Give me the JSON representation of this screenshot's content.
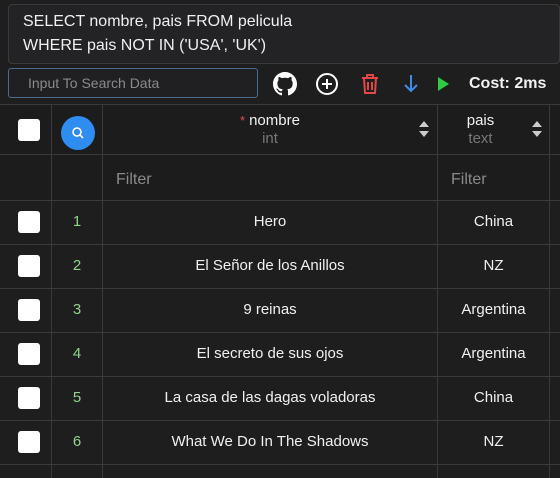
{
  "editor": {
    "line1": "SELECT nombre, pais FROM pelicula",
    "line2": "WHERE pais NOT IN ('USA', 'UK')"
  },
  "toolbar": {
    "search_placeholder": "Input To Search Data",
    "icons": [
      "github-icon",
      "add-circle-icon",
      "delete-icon",
      "download-icon",
      "run-icon"
    ],
    "cost_label": "Cost: 2ms",
    "colors": {
      "delete": "#e04848",
      "download": "#3b8de8",
      "run": "#2ecc40"
    }
  },
  "table": {
    "columns": [
      {
        "name": "nombre",
        "type": "int",
        "required": "*"
      },
      {
        "name": "pais",
        "type": "text"
      }
    ],
    "filter_placeholders": {
      "nombre": "Filter",
      "pais": "Filter"
    },
    "rows": [
      {
        "num": "1",
        "nombre": "Hero",
        "pais": "China"
      },
      {
        "num": "2",
        "nombre": "El Señor de los Anillos",
        "pais": "NZ"
      },
      {
        "num": "3",
        "nombre": "9 reinas",
        "pais": "Argentina"
      },
      {
        "num": "4",
        "nombre": "El secreto de sus ojos",
        "pais": "Argentina"
      },
      {
        "num": "5",
        "nombre": "La casa de las dagas voladoras",
        "pais": "China"
      },
      {
        "num": "6",
        "nombre": "What We Do In The Shadows",
        "pais": "NZ"
      }
    ]
  }
}
